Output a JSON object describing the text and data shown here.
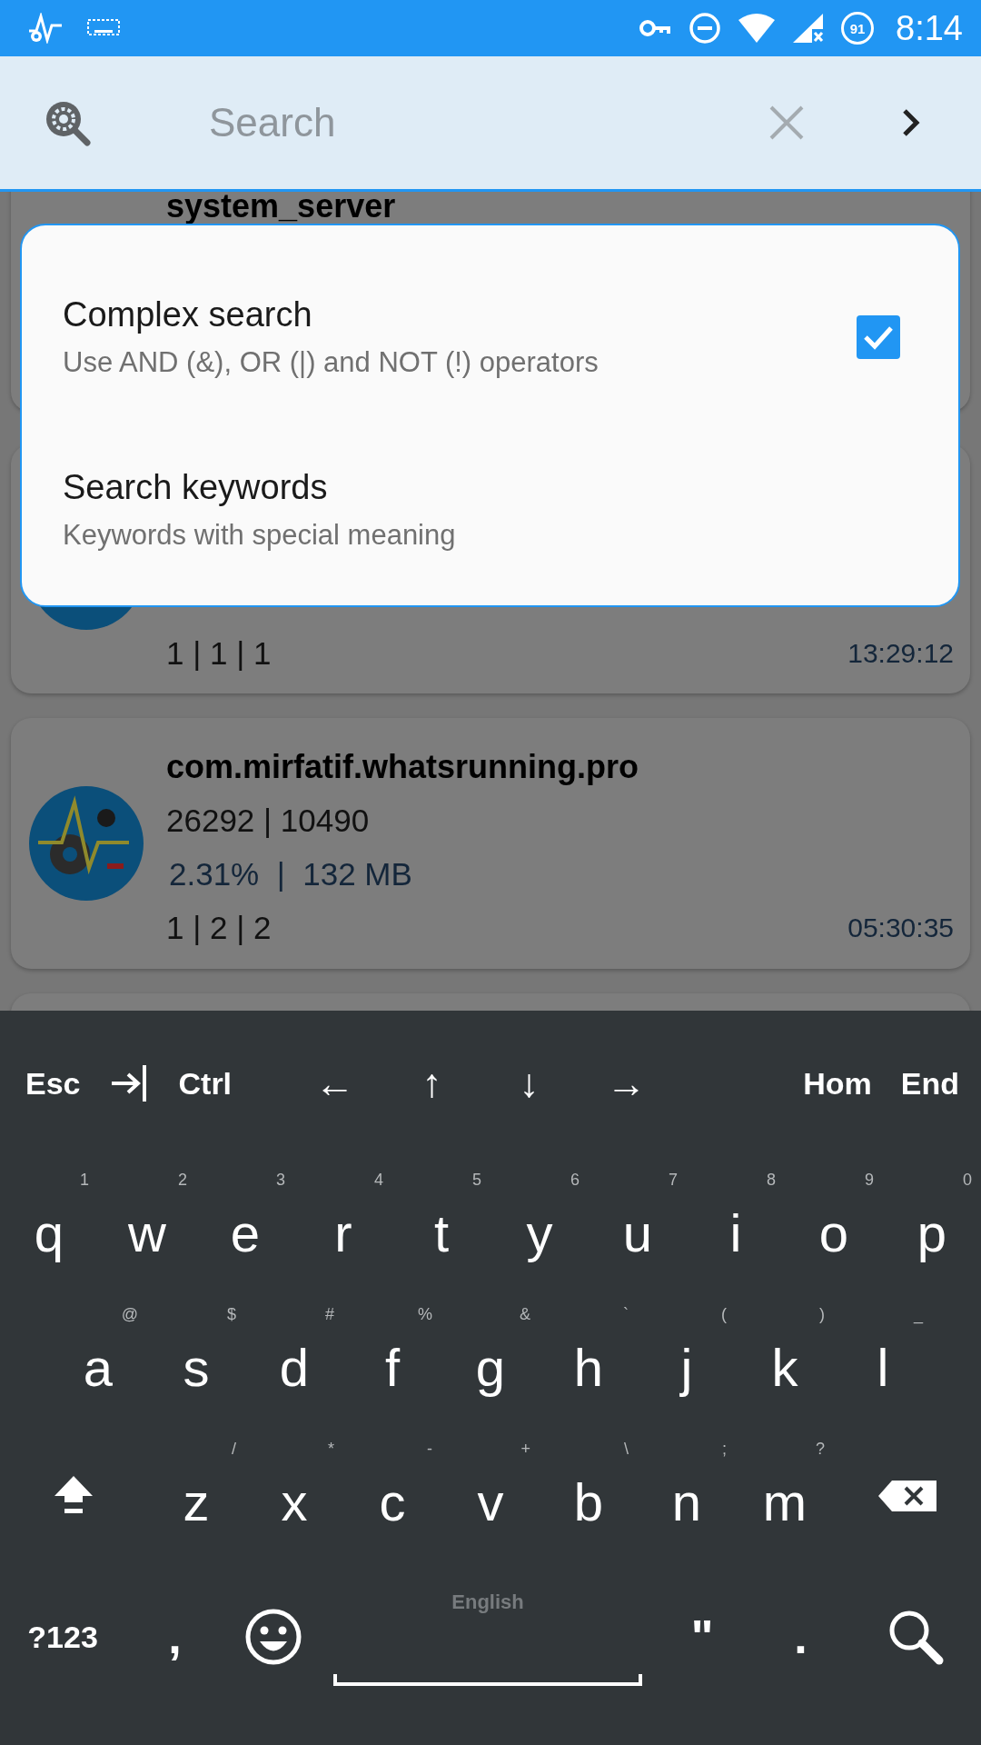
{
  "status_bar": {
    "battery": "91",
    "time": "8:14"
  },
  "search_bar": {
    "placeholder": "Search"
  },
  "process_list": [
    {
      "kind": "title_only",
      "name": "system_server"
    },
    {
      "kind": "footer_only",
      "threads": "1 | 1 | 1",
      "time": "13:29:12"
    },
    {
      "kind": "full",
      "name": "com.mirfatif.whatsrunning.pro",
      "ids": "26292 | 10490",
      "usage": "2.31%  |  132 MB",
      "threads": "1 | 2 | 2",
      "time": "05:30:35"
    },
    {
      "kind": "empty"
    }
  ],
  "search_options_menu": [
    {
      "kind": "checkbox",
      "title": "Complex search",
      "subtitle": "Use AND (&), OR (|) and NOT (!) operators",
      "checked": true
    },
    {
      "kind": "plain",
      "title": "Search keywords",
      "subtitle": "Keywords with special meaning"
    }
  ],
  "keyboard": {
    "function_row": [
      {
        "kind": "text",
        "label": "Esc"
      },
      {
        "kind": "tab"
      },
      {
        "kind": "text",
        "label": "Ctrl"
      },
      {
        "kind": "text",
        "label": "←"
      },
      {
        "kind": "text",
        "label": "↑"
      },
      {
        "kind": "text",
        "label": "↓"
      },
      {
        "kind": "text",
        "label": "→"
      },
      {
        "kind": "text",
        "label": "Hom"
      },
      {
        "kind": "text",
        "label": "End"
      }
    ],
    "top_letter_row": [
      {
        "kind": "letter",
        "label": "q",
        "hint": "1"
      },
      {
        "kind": "letter",
        "label": "w",
        "hint": "2"
      },
      {
        "kind": "letter",
        "label": "e",
        "hint": "3"
      },
      {
        "kind": "letter",
        "label": "r",
        "hint": "4"
      },
      {
        "kind": "letter",
        "label": "t",
        "hint": "5"
      },
      {
        "kind": "letter",
        "label": "y",
        "hint": "6"
      },
      {
        "kind": "letter",
        "label": "u",
        "hint": "7"
      },
      {
        "kind": "letter",
        "label": "i",
        "hint": "8"
      },
      {
        "kind": "letter",
        "label": "o",
        "hint": "9"
      },
      {
        "kind": "letter",
        "label": "p",
        "hint": "0"
      }
    ],
    "middle_letter_row": [
      {
        "kind": "letter",
        "label": "a",
        "hint": "@"
      },
      {
        "kind": "letter",
        "label": "s",
        "hint": "$"
      },
      {
        "kind": "letter",
        "label": "d",
        "hint": "#"
      },
      {
        "kind": "letter",
        "label": "f",
        "hint": "%"
      },
      {
        "kind": "letter",
        "label": "g",
        "hint": "&"
      },
      {
        "kind": "letter",
        "label": "h",
        "hint": "`"
      },
      {
        "kind": "letter",
        "label": "j",
        "hint": "("
      },
      {
        "kind": "letter",
        "label": "k",
        "hint": ")"
      },
      {
        "kind": "letter",
        "label": "l",
        "hint": "_"
      }
    ],
    "bottom_letter_row": [
      {
        "kind": "shift"
      },
      {
        "kind": "letter",
        "label": "z",
        "hint": "/"
      },
      {
        "kind": "letter",
        "label": "x",
        "hint": "*"
      },
      {
        "kind": "letter",
        "label": "c",
        "hint": "-"
      },
      {
        "kind": "letter",
        "label": "v",
        "hint": "+"
      },
      {
        "kind": "letter",
        "label": "b",
        "hint": "\\"
      },
      {
        "kind": "letter",
        "label": "n",
        "hint": ";"
      },
      {
        "kind": "letter",
        "label": "m",
        "hint": "?"
      },
      {
        "kind": "backspace"
      }
    ],
    "bottom_row": [
      {
        "kind": "symbols",
        "label": "?123"
      },
      {
        "kind": "punct",
        "label": ","
      },
      {
        "kind": "emoji"
      },
      {
        "kind": "space",
        "label": "English"
      },
      {
        "kind": "punct",
        "label": "\""
      },
      {
        "kind": "punct",
        "label": "."
      },
      {
        "kind": "search"
      }
    ]
  }
}
